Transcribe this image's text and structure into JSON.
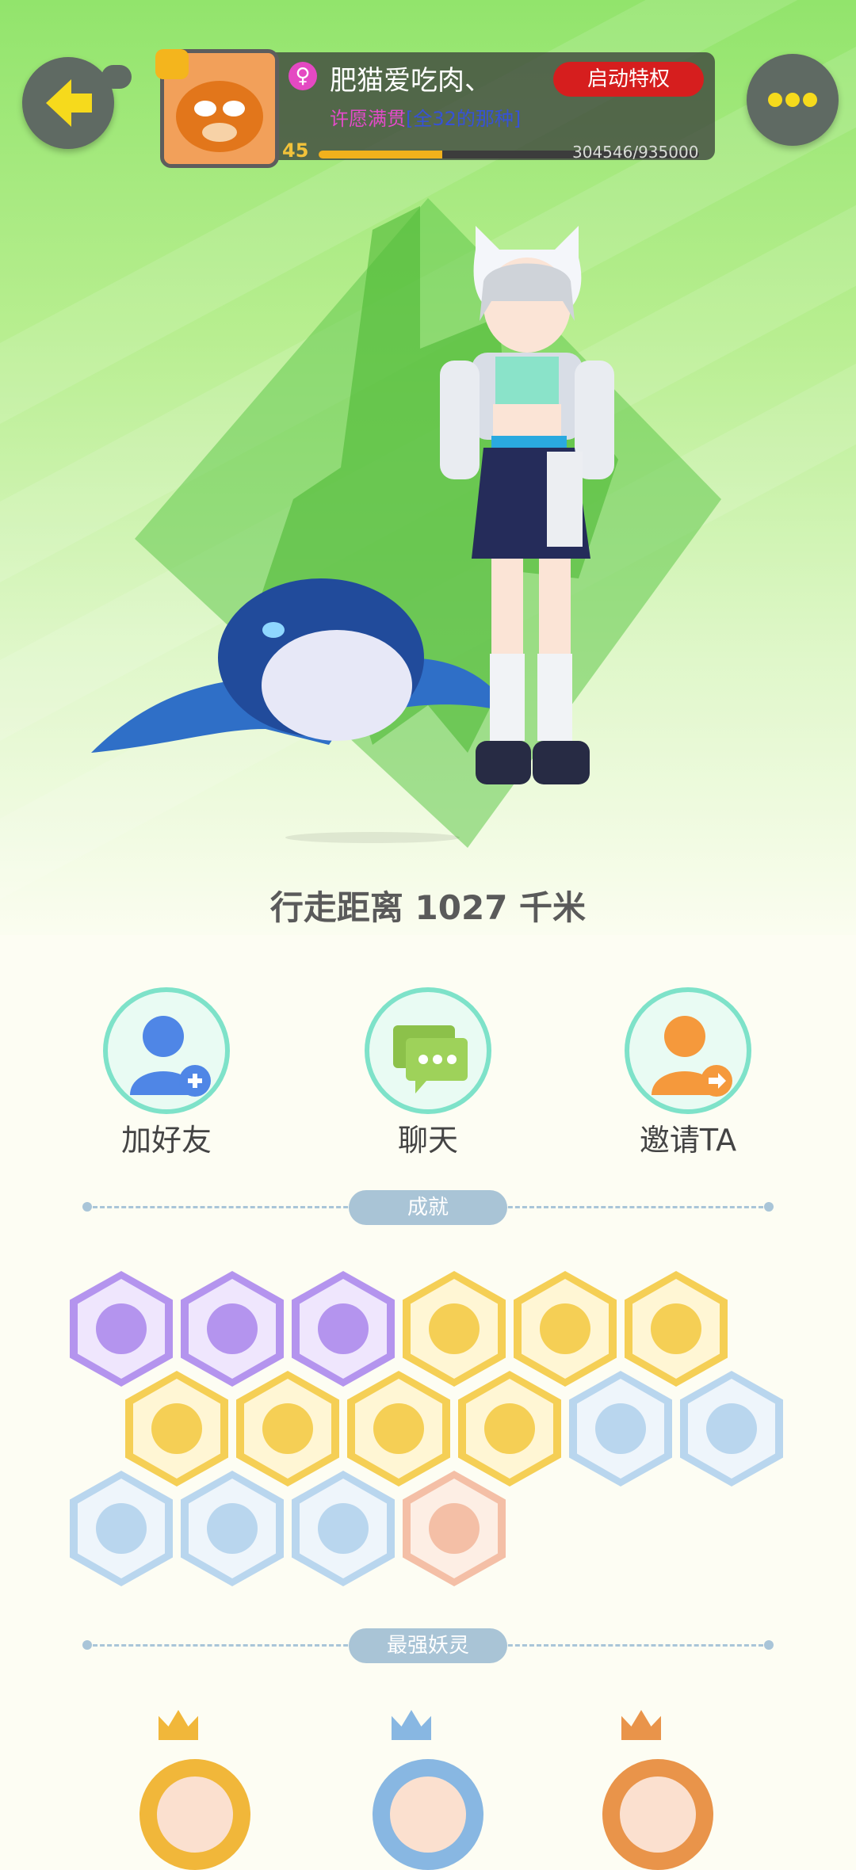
{
  "header": {
    "username": "肥猫爱吃肉、",
    "gender_icon": "female-icon",
    "guild_line_a": "许愿满贯",
    "guild_line_b": "[全32的那种]",
    "level": "45",
    "exp_text": "304546/935000",
    "exp_fraction": 0.3257,
    "privilege_label": "启动特权"
  },
  "distance_text": "行走距离 1027 千米",
  "actions": [
    {
      "label": "加好友",
      "icon": "add-friend-icon",
      "color": "#4f86e6"
    },
    {
      "label": "聊天",
      "icon": "chat-icon",
      "color": "#8cc14a"
    },
    {
      "label": "邀请TA",
      "icon": "invite-icon",
      "color": "#f5993c"
    }
  ],
  "sections": {
    "achievements": "成就",
    "strongest": "最强妖灵"
  },
  "achievement_colors": {
    "purple": "#b494ee",
    "gold": "#f5cf55",
    "blue": "#b9d6ee",
    "peach": "#f4bfa6"
  },
  "badges": [
    {
      "icon": "devil-face-icon",
      "tier": "purple"
    },
    {
      "icon": "crystal-ball-icon",
      "tier": "purple"
    },
    {
      "icon": "yin-yang-icon",
      "tier": "purple"
    },
    {
      "icon": "shoe-icon",
      "tier": "gold"
    },
    {
      "icon": "sun-medal-icon",
      "tier": "gold"
    },
    {
      "icon": "gem-icon",
      "tier": "gold"
    },
    {
      "icon": "cat-dance-icon",
      "tier": "gold"
    },
    {
      "icon": "talisman-icon",
      "tier": "gold"
    },
    {
      "icon": "fish-icon",
      "tier": "gold"
    },
    {
      "icon": "fox-book-icon",
      "tier": "gold"
    },
    {
      "icon": "moon-icon",
      "tier": "blue"
    },
    {
      "icon": "spirit-icon",
      "tier": "blue"
    },
    {
      "icon": "shield-icon",
      "tier": "blue"
    },
    {
      "icon": "demon-statue-icon",
      "tier": "blue"
    },
    {
      "icon": "ghost-cat-icon",
      "tier": "blue"
    },
    {
      "icon": "stroller-icon",
      "tier": "peach"
    }
  ],
  "spirits": [
    {
      "icon": "gold-crown-icon",
      "portrait": "spirit-portrait-1",
      "ring": "#f1b73a"
    },
    {
      "icon": "silver-crown-icon",
      "portrait": "spirit-portrait-2",
      "ring": "#88b7e2"
    },
    {
      "icon": "bronze-crown-icon",
      "portrait": "spirit-portrait-3",
      "ring": "#e9944a"
    }
  ]
}
